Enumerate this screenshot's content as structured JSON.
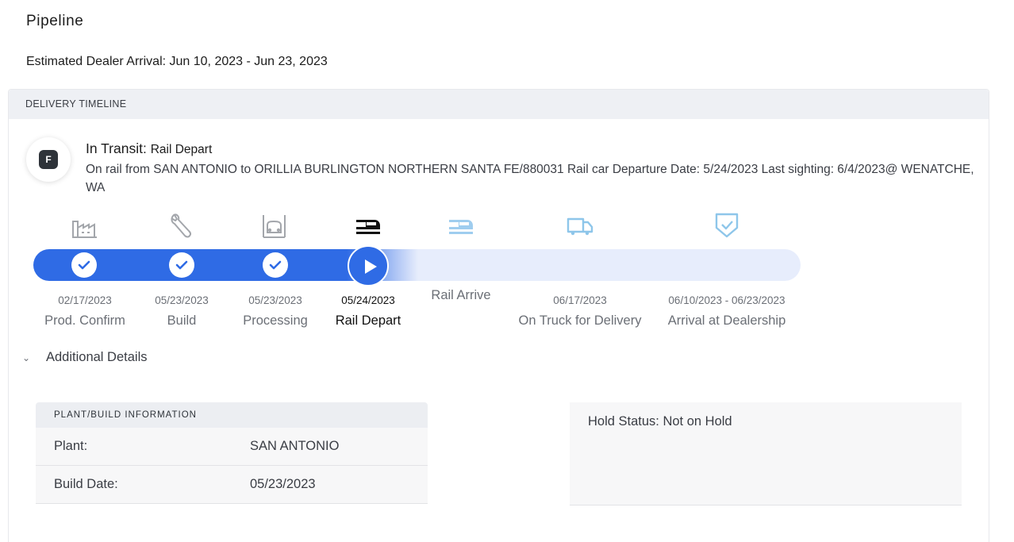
{
  "page": {
    "title": "Pipeline",
    "estimated_arrival": "Estimated Dealer Arrival: Jun 10, 2023 - Jun 23, 2023"
  },
  "timeline": {
    "header": "DELIVERY TIMELINE",
    "badge": "F",
    "status_prefix": "In Transit:",
    "status_stage": "Rail Depart",
    "status_description": "On rail from SAN ANTONIO to ORILLIA BURLINGTON NORTHERN SANTA FE/880031 Rail car Departure Date: 5/24/2023 Last sighting: 6/4/2023@ WENATCHE, WA",
    "progress_completed_steps": 3,
    "steps": [
      {
        "label": "Prod. Confirm",
        "date": "02/17/2023",
        "icon": "factory-icon",
        "state": "complete"
      },
      {
        "label": "Build",
        "date": "05/23/2023",
        "icon": "wrench-icon",
        "state": "complete"
      },
      {
        "label": "Processing",
        "date": "05/23/2023",
        "icon": "processing-icon",
        "state": "complete"
      },
      {
        "label": "Rail Depart",
        "date": "05/24/2023",
        "icon": "rail-icon",
        "state": "active"
      },
      {
        "label": "Rail Arrive",
        "date": "",
        "icon": "rail-icon",
        "state": "pending"
      },
      {
        "label": "On Truck for Delivery",
        "date": "06/17/2023",
        "icon": "truck-icon",
        "state": "pending"
      },
      {
        "label": "Arrival at Dealership",
        "date": "06/10/2023 - 06/23/2023",
        "icon": "shield-check-icon",
        "state": "pending"
      }
    ],
    "colors": {
      "progress": "#2f6be5",
      "track": "#e7edfc",
      "pending_icon": "#8ec6ea",
      "done_icon": "#9a9da3"
    }
  },
  "details": {
    "toggle_label": "Additional Details",
    "plant_header": "PLANT/BUILD INFORMATION",
    "plant_label": "Plant:",
    "plant_value": "SAN ANTONIO",
    "build_date_label": "Build Date:",
    "build_date_value": "05/23/2023",
    "hold_status": "Hold Status: Not on Hold"
  }
}
